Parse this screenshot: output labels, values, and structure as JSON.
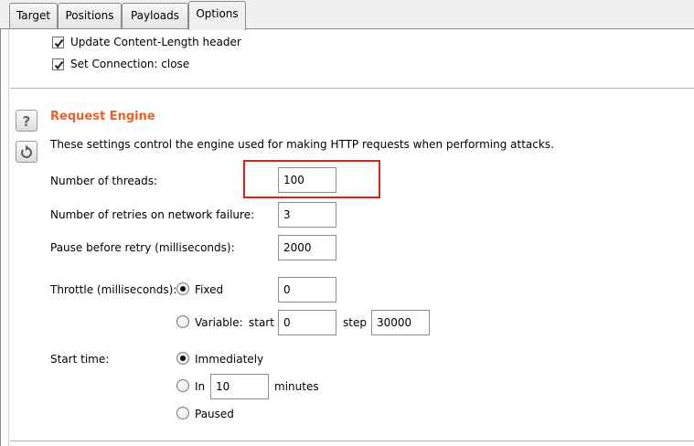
{
  "tabs": [
    {
      "label": "Target"
    },
    {
      "label": "Positions"
    },
    {
      "label": "Payloads"
    },
    {
      "label": "Options"
    }
  ],
  "active_tab": "Options",
  "request_headers": {
    "update_content_length": {
      "label": "Update Content-Length header",
      "checked": true
    },
    "set_connection_close": {
      "label": "Set Connection: close",
      "checked": true
    }
  },
  "request_engine": {
    "title": "Request Engine",
    "description": "These settings control the engine used for making HTTP requests when performing attacks.",
    "threads": {
      "label": "Number of threads:",
      "value": "100"
    },
    "retries": {
      "label": "Number of retries on network failure:",
      "value": "3"
    },
    "pause": {
      "label": "Pause before retry (milliseconds):",
      "value": "2000"
    },
    "throttle": {
      "label": "Throttle (milliseconds):",
      "fixed_label": "Fixed",
      "fixed_value": "0",
      "variable_label": "Variable:",
      "start_label": "start",
      "start_value": "0",
      "step_label": "step",
      "step_value": "30000",
      "selected": "Fixed"
    },
    "start_time": {
      "label": "Start time:",
      "immediately_label": "Immediately",
      "in_label": "In",
      "in_value": "10",
      "minutes_label": "minutes",
      "paused_label": "Paused",
      "selected": "Immediately"
    }
  },
  "icons": {
    "help": "help-icon",
    "restore": "restore-defaults-icon"
  },
  "colors": {
    "heading": "#e5622c",
    "highlight": "#d9231d"
  }
}
